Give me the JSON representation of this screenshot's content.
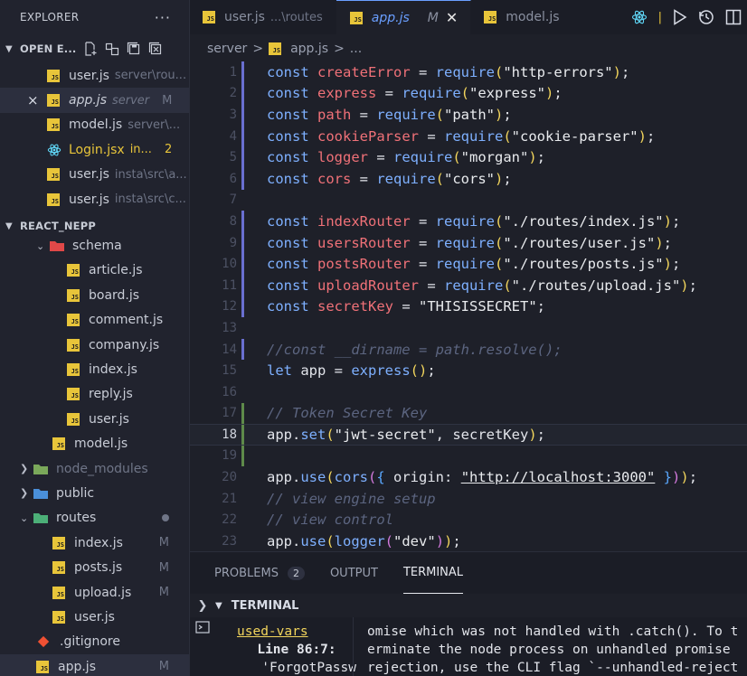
{
  "explorer": {
    "title": "EXPLORER",
    "more_label": "···",
    "open_editors": {
      "label": "OPEN E...",
      "items": [
        {
          "name": "user.js",
          "desc": "server\\rou...",
          "badge": "",
          "type": "js"
        },
        {
          "name": "app.js",
          "desc": "server",
          "badge": "M",
          "type": "js",
          "active": true,
          "italic": true,
          "close": "×"
        },
        {
          "name": "model.js",
          "desc": "server\\...",
          "badge": "",
          "type": "js"
        },
        {
          "name": "Login.jsx",
          "desc": "in...",
          "badge": "2",
          "type": "react"
        },
        {
          "name": "user.js",
          "desc": "insta\\src\\a...",
          "badge": "",
          "type": "js"
        },
        {
          "name": "user.js",
          "desc": "insta\\src\\c...",
          "badge": "",
          "type": "js"
        }
      ]
    },
    "project": {
      "label": "REACT_NEPP",
      "items": [
        {
          "name": "schema",
          "kind": "folder-open",
          "depth": 2
        },
        {
          "name": "article.js",
          "kind": "js",
          "depth": 3
        },
        {
          "name": "board.js",
          "kind": "js",
          "depth": 3
        },
        {
          "name": "comment.js",
          "kind": "js",
          "depth": 3
        },
        {
          "name": "company.js",
          "kind": "js",
          "depth": 3
        },
        {
          "name": "index.js",
          "kind": "js",
          "depth": 3
        },
        {
          "name": "reply.js",
          "kind": "js",
          "depth": 3
        },
        {
          "name": "user.js",
          "kind": "js",
          "depth": 3
        },
        {
          "name": "model.js",
          "kind": "js",
          "depth": 2
        },
        {
          "name": "node_modules",
          "kind": "folder-closed",
          "depth": 1,
          "dim": true
        },
        {
          "name": "public",
          "kind": "folder-closed-blue",
          "depth": 1
        },
        {
          "name": "routes",
          "kind": "folder-open-green",
          "depth": 1,
          "dot": true
        },
        {
          "name": "index.js",
          "kind": "js",
          "depth": 2,
          "badge": "M"
        },
        {
          "name": "posts.js",
          "kind": "js",
          "depth": 2,
          "badge": "M"
        },
        {
          "name": "upload.js",
          "kind": "js",
          "depth": 2,
          "badge": "M"
        },
        {
          "name": "user.js",
          "kind": "js",
          "depth": 2
        },
        {
          "name": ".gitignore",
          "kind": "git",
          "depth": 1
        },
        {
          "name": "app.js",
          "kind": "js",
          "depth": 1,
          "badge": "M",
          "active": true
        }
      ]
    }
  },
  "tabs": [
    {
      "name": "user.js",
      "desc": "...\\routes",
      "active": false
    },
    {
      "name": "app.js",
      "mod": "M",
      "close": "✕",
      "active": true
    },
    {
      "name": "model.js",
      "active": false
    }
  ],
  "tab_actions": [
    "react-icon",
    "pipe",
    "run-icon",
    "history-icon",
    "split-icon"
  ],
  "breadcrumb": {
    "folder": "server",
    "sep": ">",
    "file": "app.js",
    "tail": "..."
  },
  "editor": {
    "current_line": 18,
    "lines": [
      {
        "n": "1",
        "bar": "#6a6fd0",
        "tokens": [
          [
            "k",
            "const "
          ],
          [
            "v",
            "createError"
          ],
          [
            "p",
            " = "
          ],
          [
            "f",
            "require"
          ],
          [
            "b1",
            "("
          ],
          [
            "s",
            "\"http-errors\""
          ],
          [
            "b1",
            ")"
          ],
          [
            "p",
            ";"
          ]
        ]
      },
      {
        "n": "2",
        "bar": "#6a6fd0",
        "tokens": [
          [
            "k",
            "const "
          ],
          [
            "v",
            "express"
          ],
          [
            "p",
            " = "
          ],
          [
            "f",
            "require"
          ],
          [
            "b1",
            "("
          ],
          [
            "s",
            "\"express\""
          ],
          [
            "b1",
            ")"
          ],
          [
            "p",
            ";"
          ]
        ]
      },
      {
        "n": "3",
        "bar": "#6a6fd0",
        "tokens": [
          [
            "k",
            "const "
          ],
          [
            "v",
            "path"
          ],
          [
            "p",
            " = "
          ],
          [
            "f",
            "require"
          ],
          [
            "b1",
            "("
          ],
          [
            "s",
            "\"path\""
          ],
          [
            "b1",
            ")"
          ],
          [
            "p",
            ";"
          ]
        ]
      },
      {
        "n": "4",
        "bar": "#6a6fd0",
        "tokens": [
          [
            "k",
            "const "
          ],
          [
            "v",
            "cookieParser"
          ],
          [
            "p",
            " = "
          ],
          [
            "f",
            "require"
          ],
          [
            "b1",
            "("
          ],
          [
            "s",
            "\"cookie-parser\""
          ],
          [
            "b1",
            ")"
          ],
          [
            "p",
            ";"
          ]
        ]
      },
      {
        "n": "5",
        "bar": "#6a6fd0",
        "tokens": [
          [
            "k",
            "const "
          ],
          [
            "v",
            "logger"
          ],
          [
            "p",
            " = "
          ],
          [
            "f",
            "require"
          ],
          [
            "b1",
            "("
          ],
          [
            "s",
            "\"morgan\""
          ],
          [
            "b1",
            ")"
          ],
          [
            "p",
            ";"
          ]
        ]
      },
      {
        "n": "6",
        "bar": "#6a6fd0",
        "tokens": [
          [
            "k",
            "const "
          ],
          [
            "v",
            "cors"
          ],
          [
            "p",
            " = "
          ],
          [
            "f",
            "require"
          ],
          [
            "b1",
            "("
          ],
          [
            "s",
            "\"cors\""
          ],
          [
            "b1",
            ")"
          ],
          [
            "p",
            ";"
          ]
        ]
      },
      {
        "n": "7",
        "bar": "",
        "tokens": []
      },
      {
        "n": "8",
        "bar": "#6a6fd0",
        "tokens": [
          [
            "k",
            "const "
          ],
          [
            "v",
            "indexRouter"
          ],
          [
            "p",
            " = "
          ],
          [
            "f",
            "require"
          ],
          [
            "b1",
            "("
          ],
          [
            "s",
            "\"./routes/index.js\""
          ],
          [
            "b1",
            ")"
          ],
          [
            "p",
            ";"
          ]
        ]
      },
      {
        "n": "9",
        "bar": "#6a6fd0",
        "tokens": [
          [
            "k",
            "const "
          ],
          [
            "v",
            "usersRouter"
          ],
          [
            "p",
            " = "
          ],
          [
            "f",
            "require"
          ],
          [
            "b1",
            "("
          ],
          [
            "s",
            "\"./routes/user.js\""
          ],
          [
            "b1",
            ")"
          ],
          [
            "p",
            ";"
          ]
        ]
      },
      {
        "n": "10",
        "bar": "#6a6fd0",
        "tokens": [
          [
            "k",
            "const "
          ],
          [
            "v",
            "postsRouter"
          ],
          [
            "p",
            " = "
          ],
          [
            "f",
            "require"
          ],
          [
            "b1",
            "("
          ],
          [
            "s",
            "\"./routes/posts.js\""
          ],
          [
            "b1",
            ")"
          ],
          [
            "p",
            ";"
          ]
        ]
      },
      {
        "n": "11",
        "bar": "#6a6fd0",
        "tokens": [
          [
            "k",
            "const "
          ],
          [
            "v",
            "uploadRouter"
          ],
          [
            "p",
            " = "
          ],
          [
            "f",
            "require"
          ],
          [
            "b1",
            "("
          ],
          [
            "s",
            "\"./routes/upload.js\""
          ],
          [
            "b1",
            ")"
          ],
          [
            "p",
            ";"
          ]
        ]
      },
      {
        "n": "12",
        "bar": "#6a6fd0",
        "tokens": [
          [
            "k",
            "const "
          ],
          [
            "v",
            "secretKey"
          ],
          [
            "p",
            " = "
          ],
          [
            "s",
            "\"THISISSECRET\""
          ],
          [
            "p",
            ";"
          ]
        ]
      },
      {
        "n": "13",
        "bar": "",
        "tokens": []
      },
      {
        "n": "14",
        "bar": "#6a6fd0",
        "tokens": [
          [
            "c",
            "//const __dirname = path.resolve();"
          ]
        ]
      },
      {
        "n": "15",
        "bar": "",
        "tokens": [
          [
            "k",
            "let "
          ],
          [
            "p",
            "app = "
          ],
          [
            "f",
            "express"
          ],
          [
            "b1",
            "()"
          ],
          [
            "p",
            ";"
          ]
        ]
      },
      {
        "n": "16",
        "bar": "",
        "tokens": []
      },
      {
        "n": "17",
        "bar": "#5e8a4a",
        "tokens": [
          [
            "c",
            "// Token Secret Key"
          ]
        ]
      },
      {
        "n": "18",
        "bar": "#5e8a4a",
        "tokens": [
          [
            "p",
            "app."
          ],
          [
            "f",
            "set"
          ],
          [
            "b1",
            "("
          ],
          [
            "s",
            "\"jwt-secret\""
          ],
          [
            "p",
            ", secretKey"
          ],
          [
            "b1",
            ")"
          ],
          [
            "p",
            ";"
          ]
        ]
      },
      {
        "n": "19",
        "bar": "#5e8a4a",
        "tokens": []
      },
      {
        "n": "20",
        "bar": "",
        "tokens": [
          [
            "p",
            "app."
          ],
          [
            "f",
            "use"
          ],
          [
            "b1",
            "("
          ],
          [
            "f",
            "cors"
          ],
          [
            "b2",
            "("
          ],
          [
            "b3",
            "{"
          ],
          [
            "p",
            " origin: "
          ],
          [
            "su",
            "\"http://localhost:3000\""
          ],
          [
            "b3",
            " }"
          ],
          [
            "b2",
            ")"
          ],
          [
            "b1",
            ")"
          ],
          [
            "p",
            ";"
          ]
        ]
      },
      {
        "n": "21",
        "bar": "",
        "tokens": [
          [
            "c",
            "// view engine setup"
          ]
        ]
      },
      {
        "n": "22",
        "bar": "",
        "tokens": [
          [
            "c",
            "// view control"
          ]
        ]
      },
      {
        "n": "23",
        "bar": "",
        "tokens": [
          [
            "p",
            "app."
          ],
          [
            "f",
            "use"
          ],
          [
            "b1",
            "("
          ],
          [
            "f",
            "logger"
          ],
          [
            "b2",
            "("
          ],
          [
            "s",
            "\"dev\""
          ],
          [
            "b2",
            ")"
          ],
          [
            "b1",
            ")"
          ],
          [
            "p",
            ";"
          ]
        ]
      }
    ]
  },
  "panel": {
    "tabs": [
      {
        "label": "PROBLEMS",
        "count": "2",
        "active": false
      },
      {
        "label": "OUTPUT",
        "active": false
      },
      {
        "label": "TERMINAL",
        "active": true
      }
    ],
    "terminal_title": "TERMINAL",
    "left_lines": [
      "used-vars",
      "Line 86:7:",
      "'ForgotPassw"
    ],
    "right_lines": [
      "omise which was not handled with .catch(). To t",
      "erminate the node process on unhandled promise",
      "rejection, use the CLI flag `--unhandled-reject"
    ]
  }
}
